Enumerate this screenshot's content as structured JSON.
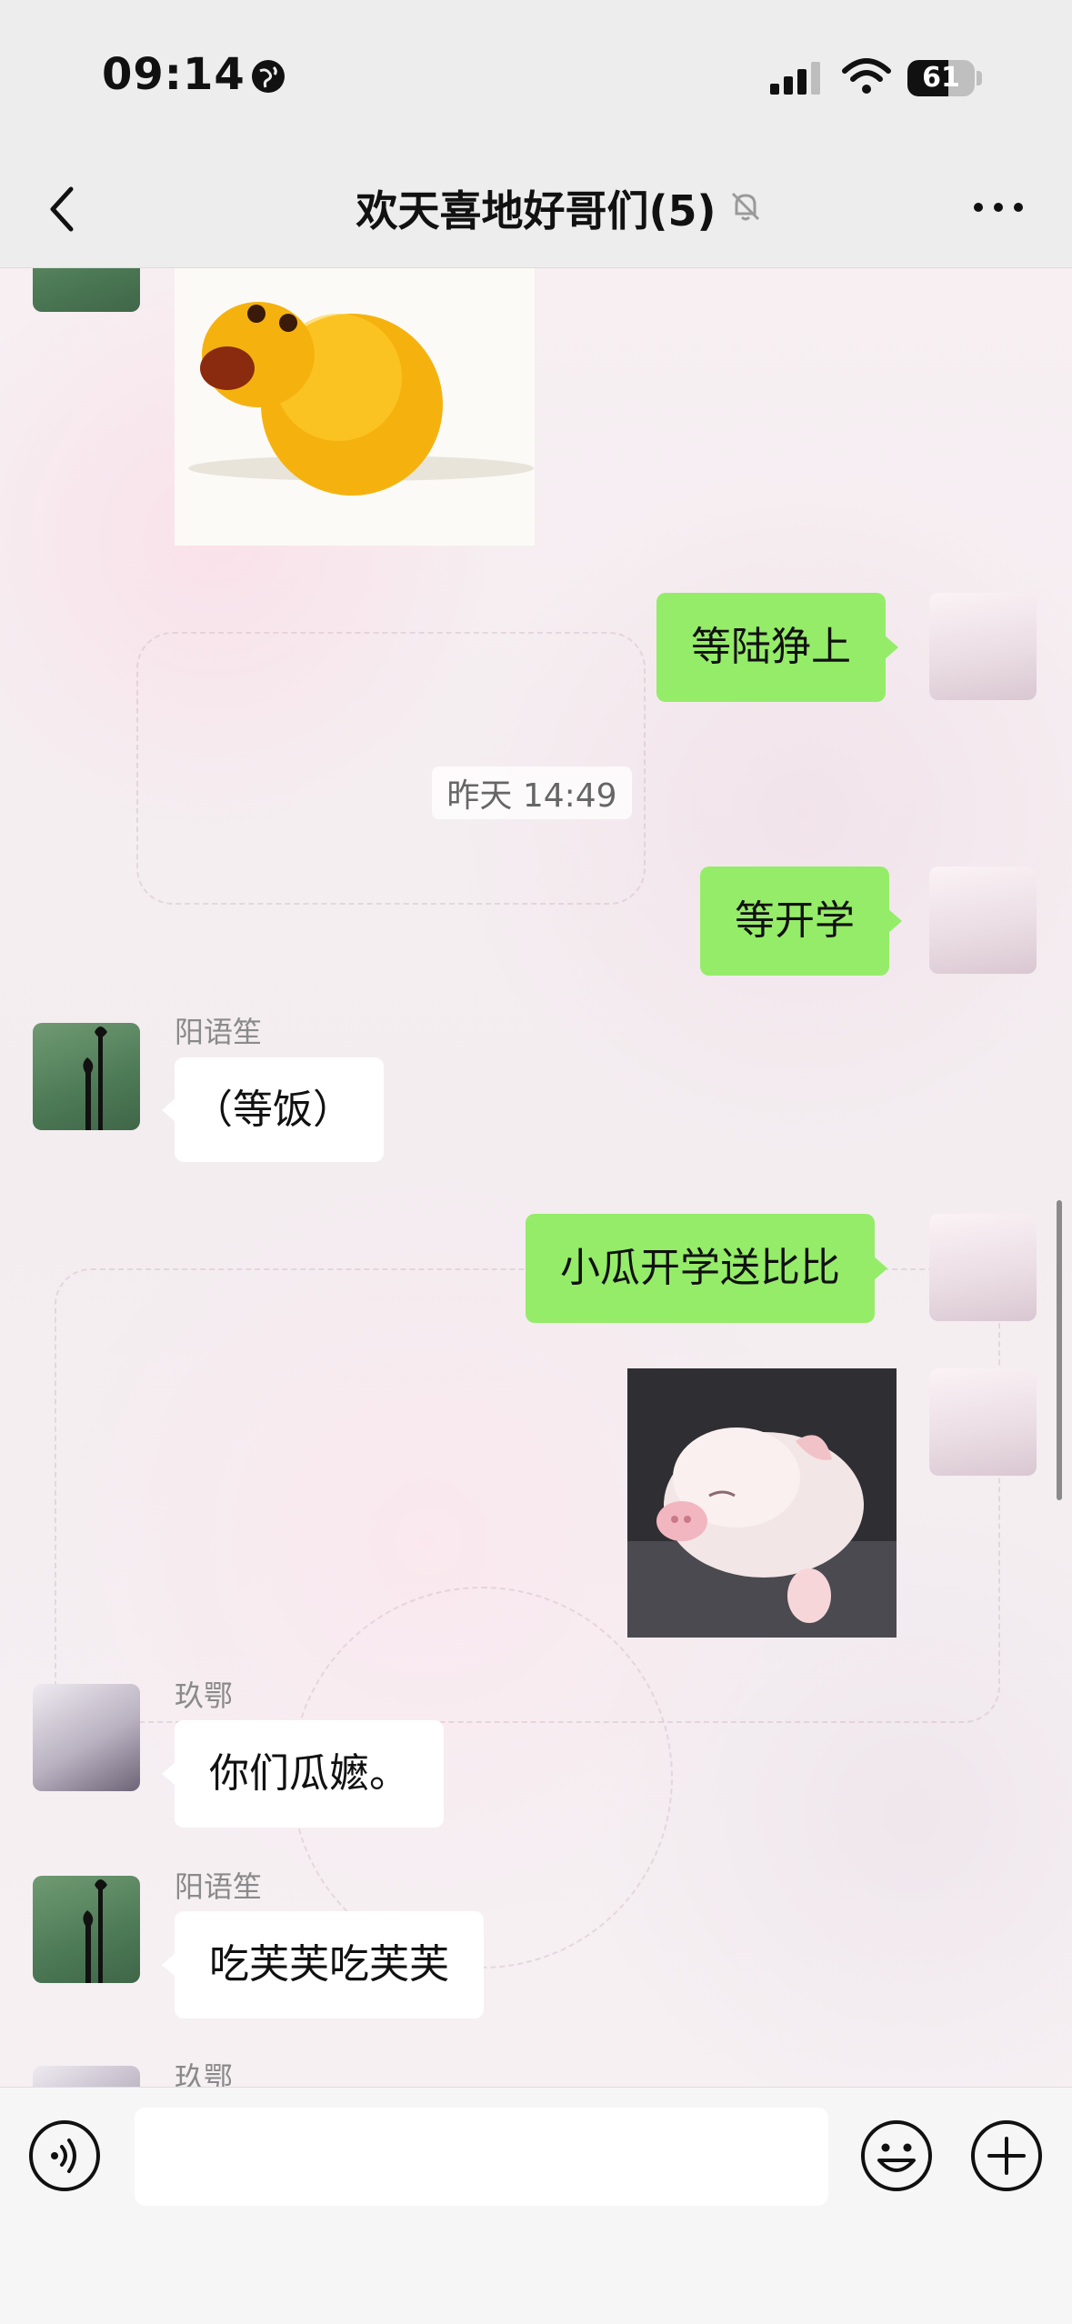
{
  "status_bar": {
    "time": "09:14",
    "battery": "61"
  },
  "nav": {
    "title": "欢天喜地好哥们(5)"
  },
  "messages": {
    "m1_text": "等陆狰上",
    "timestamp": "昨天 14:49",
    "m2_text": "等开学",
    "m3_sender": "阳语笙",
    "m3_text": "（等饭）",
    "m4_text": "小瓜开学送比比",
    "m6_sender": "玖鄂",
    "m6_text": "你们瓜嬷。",
    "m7_sender": "阳语笙",
    "m7_text": "吃芙芙吃芙芙",
    "m8_sender": "玖鄂"
  },
  "input": {
    "placeholder": ""
  },
  "colors": {
    "my_bubble": "#95ec69",
    "other_bubble": "#ffffff",
    "header_bg": "#ededed"
  }
}
